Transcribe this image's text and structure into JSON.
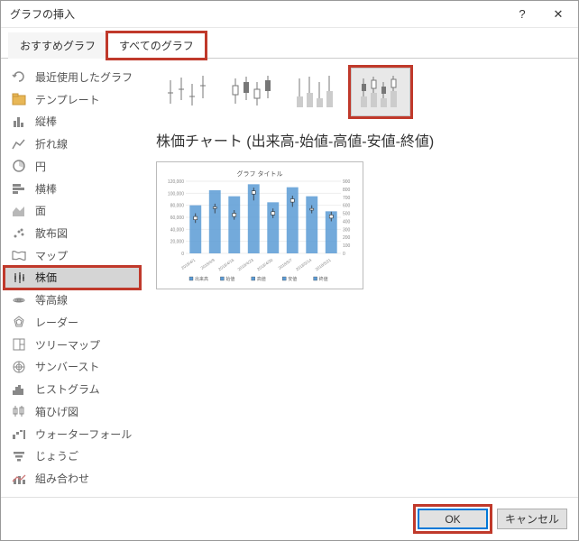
{
  "titlebar": {
    "title": "グラフの挿入",
    "help": "?",
    "close": "✕"
  },
  "tabs": {
    "recommended": "おすすめグラフ",
    "all_charts": "すべてのグラフ"
  },
  "sidebar": {
    "items": [
      {
        "label": "最近使用したグラフ",
        "icon": "recent-icon"
      },
      {
        "label": "テンプレート",
        "icon": "template-icon"
      },
      {
        "label": "縦棒",
        "icon": "column-icon"
      },
      {
        "label": "折れ線",
        "icon": "line-icon"
      },
      {
        "label": "円",
        "icon": "pie-icon"
      },
      {
        "label": "横棒",
        "icon": "bar-icon"
      },
      {
        "label": "面",
        "icon": "area-icon"
      },
      {
        "label": "散布図",
        "icon": "scatter-icon"
      },
      {
        "label": "マップ",
        "icon": "map-icon"
      },
      {
        "label": "株価",
        "icon": "stock-icon"
      },
      {
        "label": "等高線",
        "icon": "surface-icon"
      },
      {
        "label": "レーダー",
        "icon": "radar-icon"
      },
      {
        "label": "ツリーマップ",
        "icon": "treemap-icon"
      },
      {
        "label": "サンバースト",
        "icon": "sunburst-icon"
      },
      {
        "label": "ヒストグラム",
        "icon": "histogram-icon"
      },
      {
        "label": "箱ひげ図",
        "icon": "boxwhisker-icon"
      },
      {
        "label": "ウォーターフォール",
        "icon": "waterfall-icon"
      },
      {
        "label": "じょうご",
        "icon": "funnel-icon"
      },
      {
        "label": "組み合わせ",
        "icon": "combo-icon"
      }
    ],
    "selected_index": 9
  },
  "subtypes": {
    "selected_index": 3,
    "title": "株価チャート (出来高-始値-高値-安値-終値)"
  },
  "chart_data": {
    "type": "bar",
    "title": "グラフ タイトル",
    "categories": [
      "2018/4/1",
      "2018/4/9",
      "2018/4/16",
      "2018/4/23",
      "2018/4/30",
      "2018/5/7",
      "2018/5/14",
      "2018/5/21"
    ],
    "volume": [
      80000,
      105000,
      95000,
      115000,
      85000,
      110000,
      95000,
      70000
    ],
    "open": [
      420,
      560,
      460,
      740,
      480,
      640,
      540,
      440
    ],
    "high": [
      500,
      620,
      540,
      820,
      560,
      720,
      600,
      520
    ],
    "low": [
      380,
      500,
      420,
      660,
      440,
      580,
      500,
      400
    ],
    "close": [
      460,
      580,
      500,
      780,
      520,
      680,
      560,
      480
    ],
    "left_ylim": [
      0,
      120000
    ],
    "left_ticks": [
      0,
      20000,
      40000,
      60000,
      80000,
      100000,
      120000
    ],
    "right_ylim": [
      0,
      900
    ],
    "right_ticks": [
      0,
      100,
      200,
      300,
      400,
      500,
      600,
      700,
      800,
      900
    ],
    "legend": [
      "出来高",
      "始値",
      "高値",
      "安値",
      "終値"
    ]
  },
  "footer": {
    "ok": "OK",
    "cancel": "キャンセル"
  }
}
